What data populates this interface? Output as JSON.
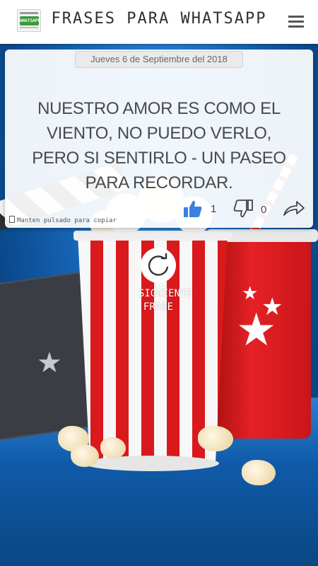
{
  "header": {
    "title": "Frases para Whatsapp",
    "logo_text": "WHATSAPP",
    "menu_icon": "hamburger-menu-icon"
  },
  "card": {
    "date": "Jueves 6 de Septiembre del 2018",
    "phrase": "NUESTRO AMOR ES COMO EL VIENTO, NO PUEDO VERLO, PERO SI SENTIRLO - UN PASEO PARA RECORDAR.",
    "copy_hint": "Manten pulsado para copiar",
    "likes": "1",
    "dislikes": "0",
    "like_icon": "thumbs-up-icon",
    "dislike_icon": "thumbs-down-icon",
    "share_icon": "share-arrow-icon"
  },
  "next": {
    "label": "SIGUIENTE\nFRASE",
    "icon": "refresh-icon"
  },
  "colors": {
    "like_blue": "#3b7fe0",
    "header_bg": "#ffffff",
    "background_blue": "#176bbd"
  }
}
